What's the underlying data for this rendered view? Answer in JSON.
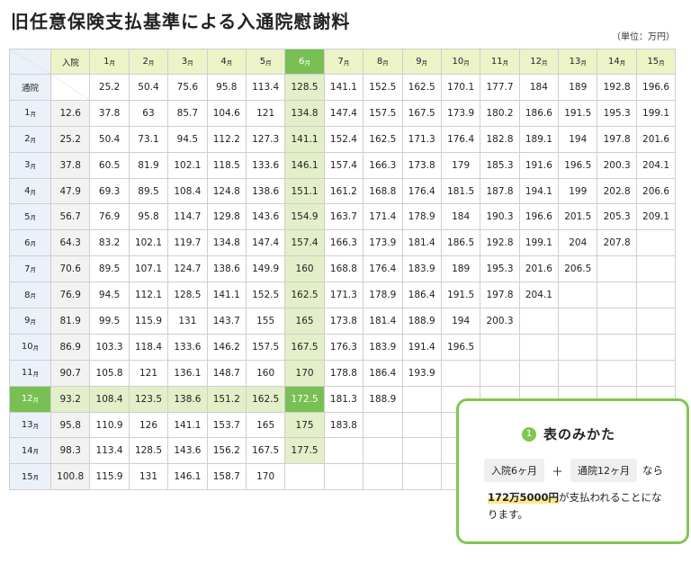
{
  "title": "旧任意保険支払基準による入通院慰謝料",
  "unit": "（単位：万円）",
  "table": {
    "col_header_label": "入院",
    "row_header_label": "通院",
    "month_suffix": "月",
    "columns": [
      "1",
      "2",
      "3",
      "4",
      "5",
      "6",
      "7",
      "8",
      "9",
      "10",
      "11",
      "12",
      "13",
      "14",
      "15"
    ],
    "rows": [
      {
        "label": "通院",
        "first": "",
        "values": [
          "25.2",
          "50.4",
          "75.6",
          "95.8",
          "113.4",
          "128.5",
          "141.1",
          "152.5",
          "162.5",
          "170.1",
          "177.7",
          "184",
          "189",
          "192.8",
          "196.6"
        ]
      },
      {
        "label": "1",
        "first": "12.6",
        "values": [
          "37.8",
          "63",
          "85.7",
          "104.6",
          "121",
          "134.8",
          "147.4",
          "157.5",
          "167.5",
          "173.9",
          "180.2",
          "186.6",
          "191.5",
          "195.3",
          "199.1"
        ]
      },
      {
        "label": "2",
        "first": "25.2",
        "values": [
          "50.4",
          "73.1",
          "94.5",
          "112.2",
          "127.3",
          "141.1",
          "152.4",
          "162.5",
          "171.3",
          "176.4",
          "182.8",
          "189.1",
          "194",
          "197.8",
          "201.6"
        ]
      },
      {
        "label": "3",
        "first": "37.8",
        "values": [
          "60.5",
          "81.9",
          "102.1",
          "118.5",
          "133.6",
          "146.1",
          "157.4",
          "166.3",
          "173.8",
          "179",
          "185.3",
          "191.6",
          "196.5",
          "200.3",
          "204.1"
        ]
      },
      {
        "label": "4",
        "first": "47.9",
        "values": [
          "69.3",
          "89.5",
          "108.4",
          "124.8",
          "138.6",
          "151.1",
          "161.2",
          "168.8",
          "176.4",
          "181.5",
          "187.8",
          "194.1",
          "199",
          "202.8",
          "206.6"
        ]
      },
      {
        "label": "5",
        "first": "56.7",
        "values": [
          "76.9",
          "95.8",
          "114.7",
          "129.8",
          "143.6",
          "154.9",
          "163.7",
          "171.4",
          "178.9",
          "184",
          "190.3",
          "196.6",
          "201.5",
          "205.3",
          "209.1"
        ]
      },
      {
        "label": "6",
        "first": "64.3",
        "values": [
          "83.2",
          "102.1",
          "119.7",
          "134.8",
          "147.4",
          "157.4",
          "166.3",
          "173.9",
          "181.4",
          "186.5",
          "192.8",
          "199.1",
          "204",
          "207.8",
          ""
        ]
      },
      {
        "label": "7",
        "first": "70.6",
        "values": [
          "89.5",
          "107.1",
          "124.7",
          "138.6",
          "149.9",
          "160",
          "168.8",
          "176.4",
          "183.9",
          "189",
          "195.3",
          "201.6",
          "206.5",
          "",
          ""
        ]
      },
      {
        "label": "8",
        "first": "76.9",
        "values": [
          "94.5",
          "112.1",
          "128.5",
          "141.1",
          "152.5",
          "162.5",
          "171.3",
          "178.9",
          "186.4",
          "191.5",
          "197.8",
          "204.1",
          "",
          "",
          ""
        ]
      },
      {
        "label": "9",
        "first": "81.9",
        "values": [
          "99.5",
          "115.9",
          "131",
          "143.7",
          "155",
          "165",
          "173.8",
          "181.4",
          "188.9",
          "194",
          "200.3",
          "",
          "",
          "",
          ""
        ]
      },
      {
        "label": "10",
        "first": "86.9",
        "values": [
          "103.3",
          "118.4",
          "133.6",
          "146.2",
          "157.5",
          "167.5",
          "176.3",
          "183.9",
          "191.4",
          "196.5",
          "",
          "",
          "",
          "",
          ""
        ]
      },
      {
        "label": "11",
        "first": "90.7",
        "values": [
          "105.8",
          "121",
          "136.1",
          "148.7",
          "160",
          "170",
          "178.8",
          "186.4",
          "193.9",
          "",
          "",
          "",
          "",
          "",
          ""
        ]
      },
      {
        "label": "12",
        "first": "93.2",
        "values": [
          "108.4",
          "123.5",
          "138.6",
          "151.2",
          "162.5",
          "172.5",
          "181.3",
          "188.9",
          "",
          "",
          "",
          "",
          "",
          "",
          ""
        ]
      },
      {
        "label": "13",
        "first": "95.8",
        "values": [
          "110.9",
          "126",
          "141.1",
          "153.7",
          "165",
          "175",
          "183.8",
          "",
          "",
          "",
          "",
          "",
          "",
          "",
          ""
        ]
      },
      {
        "label": "14",
        "first": "98.3",
        "values": [
          "113.4",
          "128.5",
          "143.6",
          "156.2",
          "167.5",
          "177.5",
          "",
          "",
          "",
          "",
          "",
          "",
          "",
          "",
          ""
        ]
      },
      {
        "label": "15",
        "first": "100.8",
        "values": [
          "115.9",
          "131",
          "146.1",
          "158.7",
          "170",
          "",
          "",
          "",
          "",
          "",
          "",
          "",
          "",
          "",
          ""
        ]
      }
    ],
    "highlight_col_index": 5,
    "highlight_row_index": 12,
    "highlight_color": "#78c054",
    "highlight_light_color": "#e2efc8"
  },
  "guide": {
    "number": "1",
    "title": "表のみかた",
    "chip1": "入院6ヶ月",
    "plus": "＋",
    "chip2": "通院12ヶ月",
    "nara": "なら",
    "amount": "172万5000円",
    "text": "が支払われることになります。",
    "border_color": "#80c750"
  }
}
